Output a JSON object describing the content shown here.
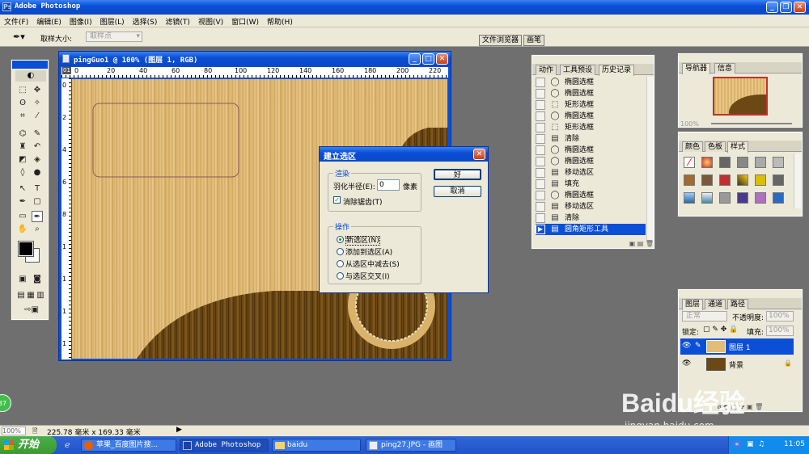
{
  "app": {
    "title": "Adobe Photoshop"
  },
  "menu": [
    "文件(F)",
    "编辑(E)",
    "图像(I)",
    "图层(L)",
    "选择(S)",
    "滤镜(T)",
    "视图(V)",
    "窗口(W)",
    "帮助(H)"
  ],
  "options": {
    "sample_label": "取样大小:",
    "sample_value": "取样点",
    "tab1": "文件浏览器",
    "tab2": "画笔"
  },
  "document": {
    "title": "pingGuo1 @ 100% (图层 1, RGB)",
    "corner": "01",
    "ruler_top": [
      "0",
      "20",
      "40",
      "60",
      "80",
      "100",
      "120",
      "140",
      "160",
      "180",
      "200",
      "220"
    ],
    "ruler_left": [
      "0",
      "2",
      "4",
      "6",
      "8",
      "1",
      "1",
      "1",
      "1"
    ]
  },
  "history": {
    "tabs": [
      "动作",
      "工具预设",
      "历史记录"
    ],
    "items": [
      "椭圆选框",
      "椭圆选框",
      "矩形选框",
      "椭圆选框",
      "矩形选框",
      "清除",
      "椭圆选框",
      "椭圆选框",
      "移动选区",
      "填充",
      "椭圆选框",
      "移动选区",
      "清除",
      "圆角矩形工具"
    ],
    "selected_index": 13
  },
  "navigator": {
    "tabs": [
      "导航器",
      "信息"
    ],
    "zoom": "100%"
  },
  "swatches": {
    "tabs": [
      "颜色",
      "色板",
      "样式"
    ]
  },
  "layers": {
    "tabs": [
      "图层",
      "通道",
      "路径"
    ],
    "blend_mode": "正常",
    "opacity_label": "不透明度:",
    "opacity": "100%",
    "lock_label": "锁定:",
    "fill_label": "填充:",
    "fill": "100%",
    "items": [
      {
        "name": "图层 1",
        "selected": true
      },
      {
        "name": "背景",
        "selected": false
      }
    ]
  },
  "dialog": {
    "title": "建立选区",
    "render_label": "渲染",
    "feather_label": "羽化半径(E):",
    "feather_value": "0",
    "unit": "像素",
    "antialias": "消除锯齿(T)",
    "ok": "好",
    "cancel": "取消",
    "op_label": "操作",
    "ops": [
      "新选区(N)",
      "添加到选区(A)",
      "从选区中减去(S)",
      "与选区交叉(I)"
    ],
    "op_selected": 0
  },
  "status": {
    "zoom": "100%",
    "size": "225.78 毫米 x 169.33 毫米"
  },
  "taskbar": {
    "start": "开始",
    "tasks": [
      "苹果_百度图片搜...",
      "Adobe Photoshop",
      "baidu",
      "ping27.JPG - 画图"
    ],
    "active": 1,
    "clock": "11:05"
  },
  "watermark": {
    "brand": "Baidu经验",
    "url": "jingyan.baidu.com"
  },
  "badge": "37",
  "colors": {
    "accent": "#0a4fd6",
    "wood_light": "#e2bd7a",
    "wood_dark": "#6b4814",
    "taskbar": "#2b5fd4",
    "start": "#3c9a2f"
  }
}
